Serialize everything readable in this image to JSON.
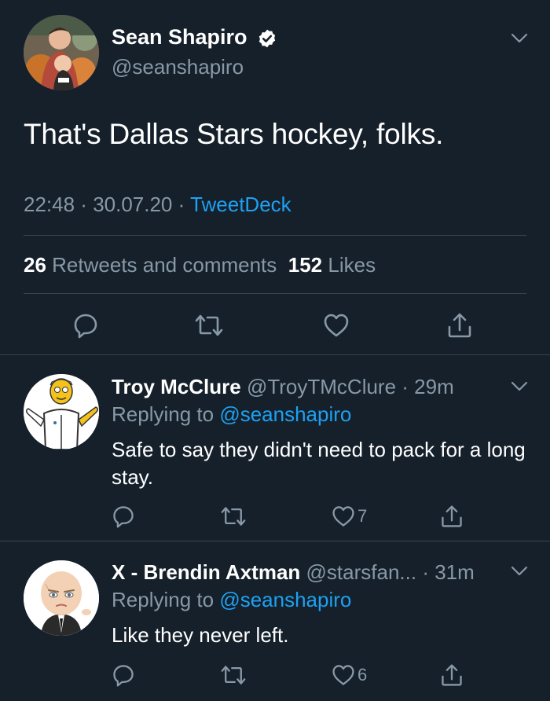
{
  "main_tweet": {
    "author": {
      "name": "Sean Shapiro",
      "handle": "@seanshapiro",
      "verified": true,
      "avatar": "profile-photo-family-pumpkins"
    },
    "text": "That's Dallas Stars hockey, folks.",
    "time": "22:48",
    "separator": " · ",
    "date": "30.07.20",
    "source": "TweetDeck",
    "stats": {
      "retweets_comments_count": "26",
      "retweets_comments_label": "Retweets and comments",
      "likes_count": "152",
      "likes_label": "Likes"
    },
    "actions": [
      "reply-icon",
      "retweet-icon",
      "like-icon",
      "share-icon"
    ]
  },
  "replies": [
    {
      "name": "Troy McClure",
      "handle": "@TroyTMcClure",
      "time": "· 29m",
      "replying_prefix": "Replying to",
      "replying_to": "@seanshapiro",
      "text": "Safe to say they didn't need to pack for a long stay.",
      "like_count": "7",
      "avatar": "cartoon-avatar-troy-mcclure"
    },
    {
      "name": "X - Brendin Axtman",
      "handle": "@starsfan...",
      "time": "· 31m",
      "replying_prefix": "Replying to",
      "replying_to": "@seanshapiro",
      "text": "Like they never left.",
      "like_count": "6",
      "avatar": "cartoon-avatar-baby"
    }
  ],
  "colors": {
    "background": "#15202b",
    "primary_text": "#ffffff",
    "secondary_text": "#8899a6",
    "accent": "#1da1f2",
    "divider": "#38444d"
  }
}
